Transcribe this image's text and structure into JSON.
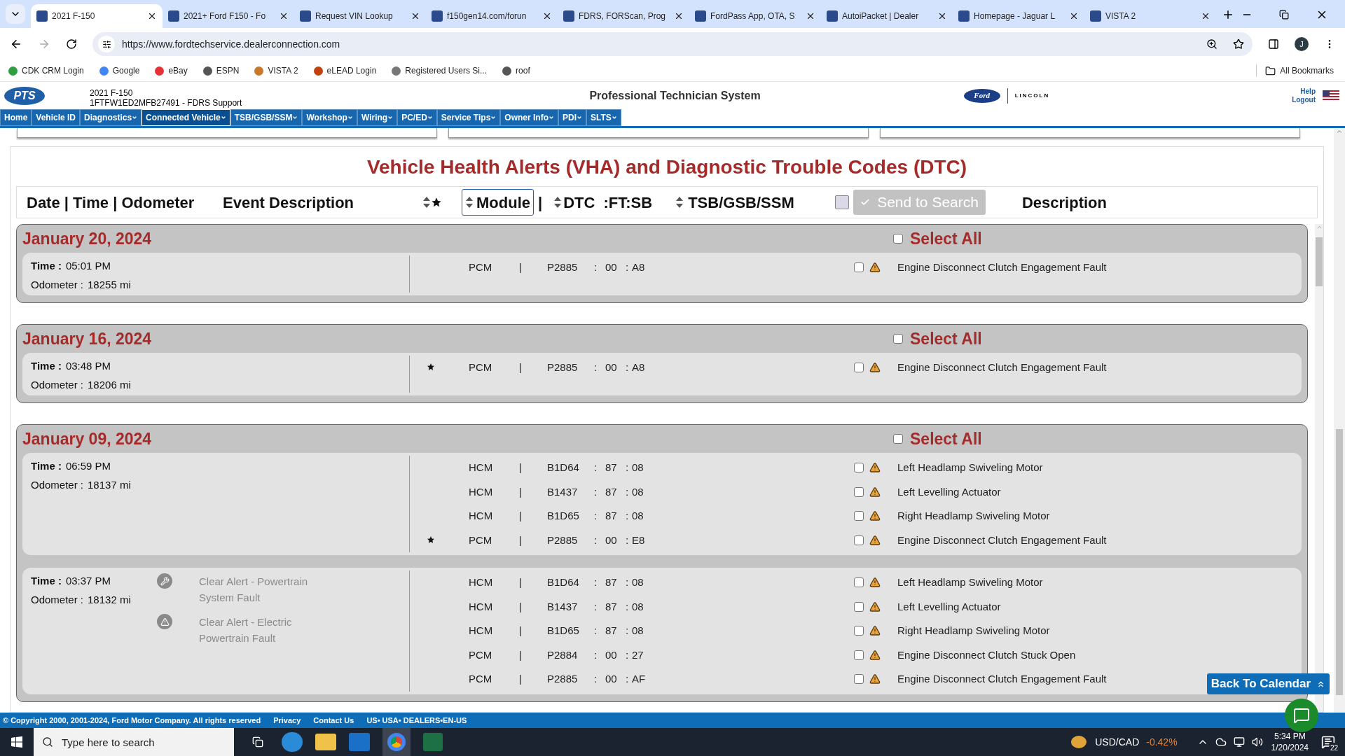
{
  "browser": {
    "tabs": [
      {
        "title": "2021 F-150",
        "selected": true
      },
      {
        "title": "2021+ Ford F150 - Fo",
        "selected": false
      },
      {
        "title": "Request VIN Lookup",
        "selected": false
      },
      {
        "title": "f150gen14.com/forun",
        "selected": false
      },
      {
        "title": "FDRS, FORScan, Prog",
        "selected": false
      },
      {
        "title": "FordPass App, OTA, S",
        "selected": false
      },
      {
        "title": "AutoiPacket | Dealer",
        "selected": false
      },
      {
        "title": "Homepage - Jaguar L",
        "selected": false
      },
      {
        "title": "VISTA 2",
        "selected": false
      }
    ],
    "url": "https://www.fordtechservice.dealerconnection.com",
    "profile_initial": "J",
    "bookmarks": [
      {
        "label": "CDK CRM Login",
        "color": "#2e9e3e"
      },
      {
        "label": "Google",
        "color": "#4285f4"
      },
      {
        "label": "eBay",
        "color": "#e53238"
      },
      {
        "label": "ESPN",
        "color": "#555555"
      },
      {
        "label": "VISTA 2",
        "color": "#c9772b"
      },
      {
        "label": "eLEAD Login",
        "color": "#c2410c"
      },
      {
        "label": "Registered Users Si...",
        "color": "#777777"
      },
      {
        "label": "roof",
        "color": "#555555"
      }
    ],
    "all_bookmarks": "All Bookmarks"
  },
  "header": {
    "logo": "PTS",
    "vehicle": "2021 F-150",
    "vin": "1FTFW1ED2MFB27491 - FDRS Support",
    "title": "Professional Technician System",
    "ford": "Ford",
    "lincoln": "LINCOLN",
    "help": "Help",
    "logout": "Logout"
  },
  "nav": [
    {
      "label": "Home",
      "dropdown": false,
      "selected": false
    },
    {
      "label": "Vehicle ID",
      "dropdown": false,
      "selected": false
    },
    {
      "label": "Diagnostics",
      "dropdown": true,
      "selected": false
    },
    {
      "label": "Connected Vehicle",
      "dropdown": true,
      "selected": true
    },
    {
      "label": "TSB/GSB/SSM",
      "dropdown": true,
      "selected": false
    },
    {
      "label": "Workshop",
      "dropdown": true,
      "selected": false
    },
    {
      "label": "Wiring",
      "dropdown": true,
      "selected": false
    },
    {
      "label": "PC/ED",
      "dropdown": true,
      "selected": false
    },
    {
      "label": "Service Tips",
      "dropdown": true,
      "selected": false
    },
    {
      "label": "Owner Info",
      "dropdown": true,
      "selected": false
    },
    {
      "label": "PDI",
      "dropdown": true,
      "selected": false
    },
    {
      "label": "SLTS",
      "dropdown": true,
      "selected": false
    }
  ],
  "page": {
    "title": "Vehicle Health Alerts (VHA) and Diagnostic Trouble Codes (DTC)",
    "columns": {
      "date": "Date | Time | Odometer",
      "event": "Event Description",
      "module": "Module",
      "separator": "|",
      "dtc": "DTC",
      "ft_sb": ":FT:SB",
      "tsb": "TSB/GSB/SSM",
      "description": "Description"
    },
    "module_sort_selected": true,
    "send_to_search": {
      "label": "Send to Search",
      "disabled": true
    },
    "back_to_calendar": "Back To Calendar"
  },
  "days": [
    {
      "date": "January 20, 2024",
      "select_all": "Select All",
      "checked": false,
      "entries": [
        {
          "time_label": "Time :",
          "time": "05:01 PM",
          "odometer_label": "Odometer :",
          "odometer": "18255 mi",
          "dtcs": [
            {
              "starred": false,
              "module": "PCM",
              "sep": "|",
              "dtc": "P2885",
              "c1": ":",
              "ft": "00",
              "c2": ":",
              "sb": "A8",
              "checked": false,
              "description": "Engine Disconnect Clutch Engagement Fault"
            }
          ]
        }
      ]
    },
    {
      "date": "January 16, 2024",
      "select_all": "Select All",
      "checked": false,
      "entries": [
        {
          "time_label": "Time :",
          "time": "03:48 PM",
          "odometer_label": "Odometer :",
          "odometer": "18206 mi",
          "dtcs": [
            {
              "starred": true,
              "module": "PCM",
              "sep": "|",
              "dtc": "P2885",
              "c1": ":",
              "ft": "00",
              "c2": ":",
              "sb": "A8",
              "checked": false,
              "description": "Engine Disconnect Clutch Engagement Fault"
            }
          ]
        }
      ]
    },
    {
      "date": "January 09, 2024",
      "select_all": "Select All",
      "checked": false,
      "entries": [
        {
          "time_label": "Time :",
          "time": "06:59 PM",
          "odometer_label": "Odometer :",
          "odometer": "18137 mi",
          "dtcs": [
            {
              "starred": false,
              "module": "HCM",
              "sep": "|",
              "dtc": "B1D64",
              "c1": ":",
              "ft": "87",
              "c2": ":",
              "sb": "08",
              "checked": false,
              "description": "Left Headlamp Swiveling Motor"
            },
            {
              "starred": false,
              "module": "HCM",
              "sep": "|",
              "dtc": "B1437",
              "c1": ":",
              "ft": "87",
              "c2": ":",
              "sb": "08",
              "checked": false,
              "description": "Left Levelling Actuator"
            },
            {
              "starred": false,
              "module": "HCM",
              "sep": "|",
              "dtc": "B1D65",
              "c1": ":",
              "ft": "87",
              "c2": ":",
              "sb": "08",
              "checked": false,
              "description": "Right Headlamp Swiveling Motor"
            },
            {
              "starred": true,
              "module": "PCM",
              "sep": "|",
              "dtc": "P2885",
              "c1": ":",
              "ft": "00",
              "c2": ":",
              "sb": "E8",
              "checked": false,
              "description": "Engine Disconnect Clutch Engagement Fault"
            }
          ]
        },
        {
          "time_label": "Time :",
          "time": "03:37 PM",
          "odometer_label": "Odometer :",
          "odometer": "18132 mi",
          "events": [
            {
              "kind": "wrench",
              "text": "Clear Alert - Powertrain System Fault"
            },
            {
              "kind": "warning",
              "text": "Clear Alert - Electric Powertrain Fault"
            }
          ],
          "dtcs": [
            {
              "starred": false,
              "module": "HCM",
              "sep": "|",
              "dtc": "B1D64",
              "c1": ":",
              "ft": "87",
              "c2": ":",
              "sb": "08",
              "checked": false,
              "description": "Left Headlamp Swiveling Motor"
            },
            {
              "starred": false,
              "module": "HCM",
              "sep": "|",
              "dtc": "B1437",
              "c1": ":",
              "ft": "87",
              "c2": ":",
              "sb": "08",
              "checked": false,
              "description": "Left Levelling Actuator"
            },
            {
              "starred": false,
              "module": "HCM",
              "sep": "|",
              "dtc": "B1D65",
              "c1": ":",
              "ft": "87",
              "c2": ":",
              "sb": "08",
              "checked": false,
              "description": "Right Headlamp Swiveling Motor"
            },
            {
              "starred": false,
              "module": "PCM",
              "sep": "|",
              "dtc": "P2884",
              "c1": ":",
              "ft": "00",
              "c2": ":",
              "sb": "27",
              "checked": false,
              "description": "Engine Disconnect Clutch Stuck Open"
            },
            {
              "starred": false,
              "module": "PCM",
              "sep": "|",
              "dtc": "P2885",
              "c1": ":",
              "ft": "00",
              "c2": ":",
              "sb": "AF",
              "checked": false,
              "description": "Engine Disconnect Clutch Engagement Fault"
            }
          ]
        }
      ]
    }
  ],
  "footer": {
    "copyright": "© Copyright 2000, 2001-2024, Ford Motor Company. All rights reserved",
    "links": [
      "Privacy",
      "Contact Us",
      "US• USA• DEALERS•EN-US"
    ]
  },
  "taskbar": {
    "search_placeholder": "Type here to search",
    "ticker": "USD/CAD",
    "change": "-0.42%",
    "time": "5:34 PM",
    "date": "1/20/2024",
    "notifications": "22"
  }
}
